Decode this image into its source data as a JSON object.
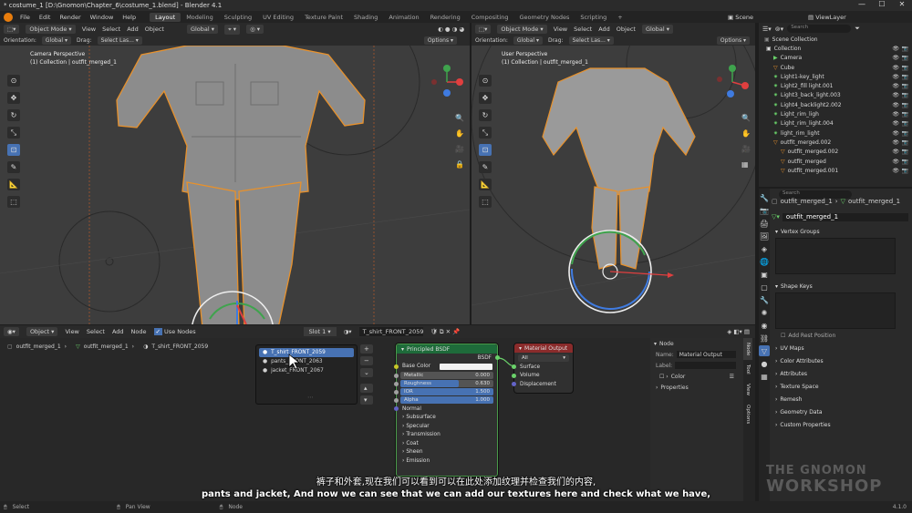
{
  "window": {
    "title": "* costume_1 [D:\\Gnomon\\Chapter_6\\costume_1.blend] - Blender 4.1",
    "controls": [
      "—",
      "☐",
      "✕"
    ]
  },
  "menu": {
    "items": [
      "File",
      "Edit",
      "Render",
      "Window",
      "Help"
    ],
    "workspaces": [
      "Layout",
      "Modeling",
      "Sculpting",
      "UV Editing",
      "Texture Paint",
      "Shading",
      "Animation",
      "Rendering",
      "Compositing",
      "Geometry Nodes",
      "Scripting"
    ],
    "active_workspace": "Layout",
    "scene": "Scene",
    "view_layer": "ViewLayer"
  },
  "viewport_left": {
    "mode": "Object Mode",
    "menus": [
      "View",
      "Select",
      "Add",
      "Object"
    ],
    "transform": "Global",
    "orientation_label": "Orientation:",
    "orientation": "Global",
    "drag_label": "Drag:",
    "drag": "Select Las...",
    "options": "Options",
    "view_name": "Camera Perspective",
    "collection": "(1) Collection | outfit_merged_1"
  },
  "viewport_right": {
    "mode": "Object Mode",
    "menus": [
      "View",
      "Select",
      "Add",
      "Object"
    ],
    "transform": "Global",
    "orientation_label": "Orientation:",
    "orientation": "Global",
    "drag_label": "Drag:",
    "drag": "Select Las...",
    "options": "Options",
    "view_name": "User Perspective",
    "collection": "(1) Collection | outfit_merged_1"
  },
  "tools": [
    "cursor",
    "move",
    "rotate",
    "scale",
    "transform",
    "annotate",
    "measure",
    "add-cube"
  ],
  "outliner": {
    "search_placeholder": "Search",
    "root": "Scene Collection",
    "items": [
      {
        "label": "Collection",
        "icon": "collection-icon",
        "indent": 1
      },
      {
        "label": "Camera",
        "icon": "camera-icon",
        "indent": 2
      },
      {
        "label": "Cube",
        "icon": "mesh-icon",
        "indent": 2
      },
      {
        "label": "Light1-key_light",
        "icon": "light-icon",
        "indent": 2
      },
      {
        "label": "Light2_fill light.001",
        "icon": "light-icon",
        "indent": 2
      },
      {
        "label": "Light3_back_light.003",
        "icon": "light-icon",
        "indent": 2
      },
      {
        "label": "Light4_backlight2.002",
        "icon": "light-icon",
        "indent": 2
      },
      {
        "label": "Light_rim_ligh",
        "icon": "light-icon",
        "indent": 2
      },
      {
        "label": "Light_rim_light.004",
        "icon": "light-icon",
        "indent": 2
      },
      {
        "label": "light_rim_light",
        "icon": "light-icon",
        "indent": 2
      },
      {
        "label": "outfit_merged.002",
        "icon": "mesh-icon",
        "indent": 2
      },
      {
        "label": "outfit_merged.002",
        "icon": "mesh-icon",
        "indent": 3
      },
      {
        "label": "outfit_merged",
        "icon": "mesh-icon",
        "indent": 3
      },
      {
        "label": "outfit_merged.001",
        "icon": "mesh-icon",
        "indent": 3
      }
    ]
  },
  "properties": {
    "search_placeholder": "Search",
    "breadcrumb": [
      "outfit_merged_1",
      "outfit_merged_1"
    ],
    "data_name": "outfit_merged_1",
    "sections": {
      "vertex_groups": "Vertex Groups",
      "shape_keys": "Shape Keys",
      "add_rest": "Add Rest Position",
      "uv_maps": "UV Maps",
      "color_attributes": "Color Attributes",
      "attributes": "Attributes",
      "texture_space": "Texture Space",
      "remesh": "Remesh",
      "geometry_data": "Geometry Data",
      "custom_properties": "Custom Properties"
    }
  },
  "node_editor": {
    "header": {
      "type": "Object",
      "menus": [
        "View",
        "Select",
        "Add",
        "Node"
      ],
      "use_nodes": "Use Nodes",
      "slot": "Slot 1",
      "material": "T_shirt_FRONT_2059"
    },
    "breadcrumb": [
      "outfit_merged_1",
      "outfit_merged_1",
      "T_shirt_FRONT_2059"
    ],
    "material_slots": [
      "T_shirt_FRONT_2059",
      "pants_FRONT_2063",
      "jacket_FRONT_2067"
    ],
    "bsdf": {
      "title": "Principled BSDF",
      "out": "BSDF",
      "base_color": "Base Color",
      "fields": [
        {
          "label": "Metallic",
          "value": "0.000",
          "fill": 0
        },
        {
          "label": "Roughness",
          "value": "0.630",
          "fill": 0.63
        },
        {
          "label": "IOR",
          "value": "1.500",
          "fill": 1
        },
        {
          "label": "Alpha",
          "value": "1.000",
          "fill": 1
        }
      ],
      "rows": [
        "Normal",
        "Subsurface",
        "Specular",
        "Transmission",
        "Coat",
        "Sheen",
        "Emission"
      ]
    },
    "output": {
      "title": "Material Output",
      "target": "All",
      "inputs": [
        "Surface",
        "Volume",
        "Displacement"
      ]
    },
    "sidebar": {
      "title": "Node",
      "name_label": "Name:",
      "name": "Material Output",
      "label_label": "Label:",
      "color": "Color",
      "properties": "Properties",
      "tabs": [
        "Node",
        "Tool",
        "View",
        "Options"
      ]
    }
  },
  "subtitles": {
    "zh": "裤子和外套,现在我们可以看到可以在此处添加纹理并检查我们的内容,",
    "en": "pants and jacket, And now we can see that we can add our textures here and check what we have,"
  },
  "watermark": {
    "line1": "THE GNOMON",
    "line2": "WORKSHOP"
  },
  "status": {
    "select": "Select",
    "pan": "Pan View",
    "node": "Node",
    "version": "4.1.0"
  },
  "colors": {
    "accent": "#4772b3",
    "selection_outline": "#e8912b",
    "bsdf_header": "#1e6b3a",
    "output_header": "#8a2b2b"
  }
}
